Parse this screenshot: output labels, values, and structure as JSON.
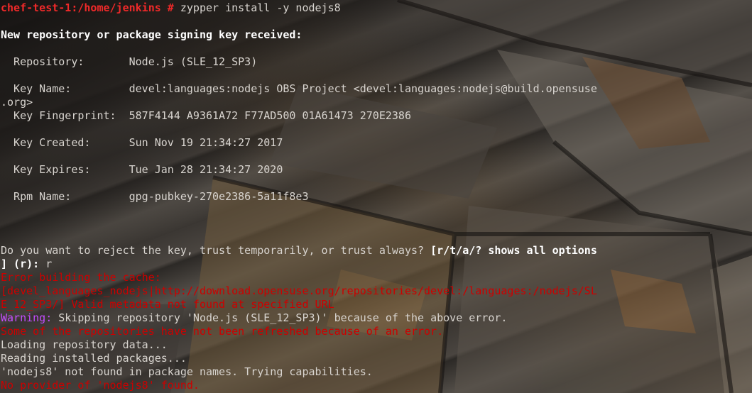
{
  "terminal": {
    "prompt": "chef-test-1:/home/jenkins #",
    "command": " zypper install -y nodejs8",
    "header": "New repository or package signing key received:",
    "fields": [
      {
        "label": "  Repository:       ",
        "value": "Node.js (SLE_12_SP3)"
      },
      {
        "label": "  Key Name:         ",
        "value": "devel:languages:nodejs OBS Project <devel:languages:nodejs@build.opensuse"
      },
      {
        "label": "  Key Fingerprint:  ",
        "value": "587F4144 A9361A72 F77AD500 01A61473 270E2386"
      },
      {
        "label": "  Key Created:      ",
        "value": "Sun Nov 19 21:34:27 2017"
      },
      {
        "label": "  Key Expires:      ",
        "value": "Tue Jan 28 21:34:27 2020"
      },
      {
        "label": "  Rpm Name:         ",
        "value": "gpg-pubkey-270e2386-5a11f8e3"
      }
    ],
    "key_name_wrap": ".org>",
    "question": "Do you want to reject the key, trust temporarily, or trust always? ",
    "question_options": "[r/t/a/? shows all options",
    "question_options_wrap": "] (r):",
    "answer": " r",
    "error_building": "Error building the cache:",
    "error_url_1": "[devel_languages_nodejs|http://download.opensuse.org/repositories/devel:/languages:/nodejs/SL",
    "error_url_2": "E_12_SP3/] Valid metadata not found at specified URL",
    "warning_label": "Warning:",
    "warning_text": " Skipping repository 'Node.js (SLE_12_SP3)' because of the above error.",
    "some_repos": "Some of the repositories have not been refreshed because of an error.",
    "loading": "Loading repository data...",
    "reading": "Reading installed packages...",
    "not_found": "'nodejs8' not found in package names. Trying capabilities.",
    "no_provider": "No provider of 'nodejs8' found."
  },
  "colors": {
    "prompt": "#ef2929",
    "error": "#cc0000",
    "warning": "#c44dff",
    "text": "#d8d4cf"
  }
}
